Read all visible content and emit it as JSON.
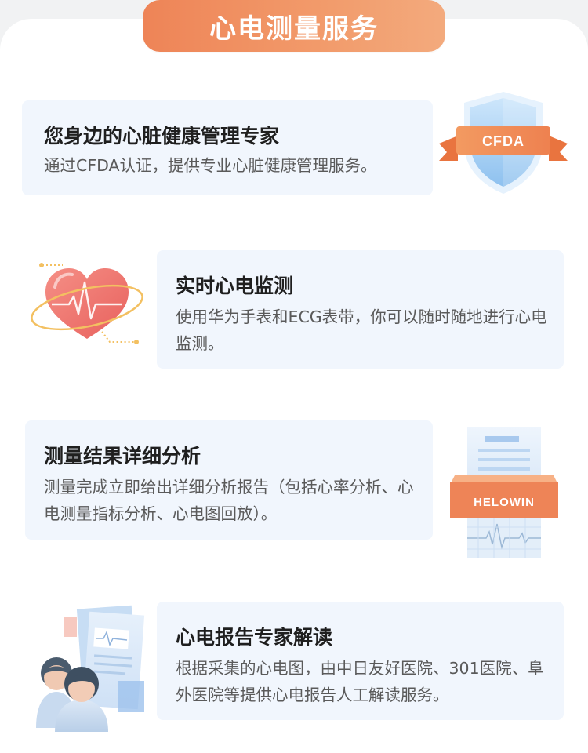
{
  "header": {
    "title": "心电测量服务"
  },
  "features": [
    {
      "title": "您身边的心脏健康管理专家",
      "description": "通过CFDA认证，提供专业心脏健康管理服务。",
      "illustration": "cfda-shield-icon",
      "badge_text": "CFDA"
    },
    {
      "title": "实时心电监测",
      "description": "使用华为手表和ECG表带，你可以随时随地进行心电监测。",
      "illustration": "heart-ecg-icon"
    },
    {
      "title": "测量结果详细分析",
      "description": "测量完成立即给出详细分析报告（包括心率分析、心电测量指标分析、心电图回放）。",
      "illustration": "report-printer-icon",
      "badge_text": "HELOWIN"
    },
    {
      "title": "心电报告专家解读",
      "description": "根据采集的心电图，由中日友好医院、301医院、阜外医院等提供心电报告人工解读服务。",
      "illustration": "doctors-report-icon"
    }
  ],
  "colors": {
    "accent": "#ee8457",
    "card_bg": "#f1f6fd",
    "shield_blue": "#8fc3f2",
    "heart_red": "#ef6f6c",
    "text_dark": "#1f1f1f",
    "text_gray": "#5a5a5a"
  }
}
